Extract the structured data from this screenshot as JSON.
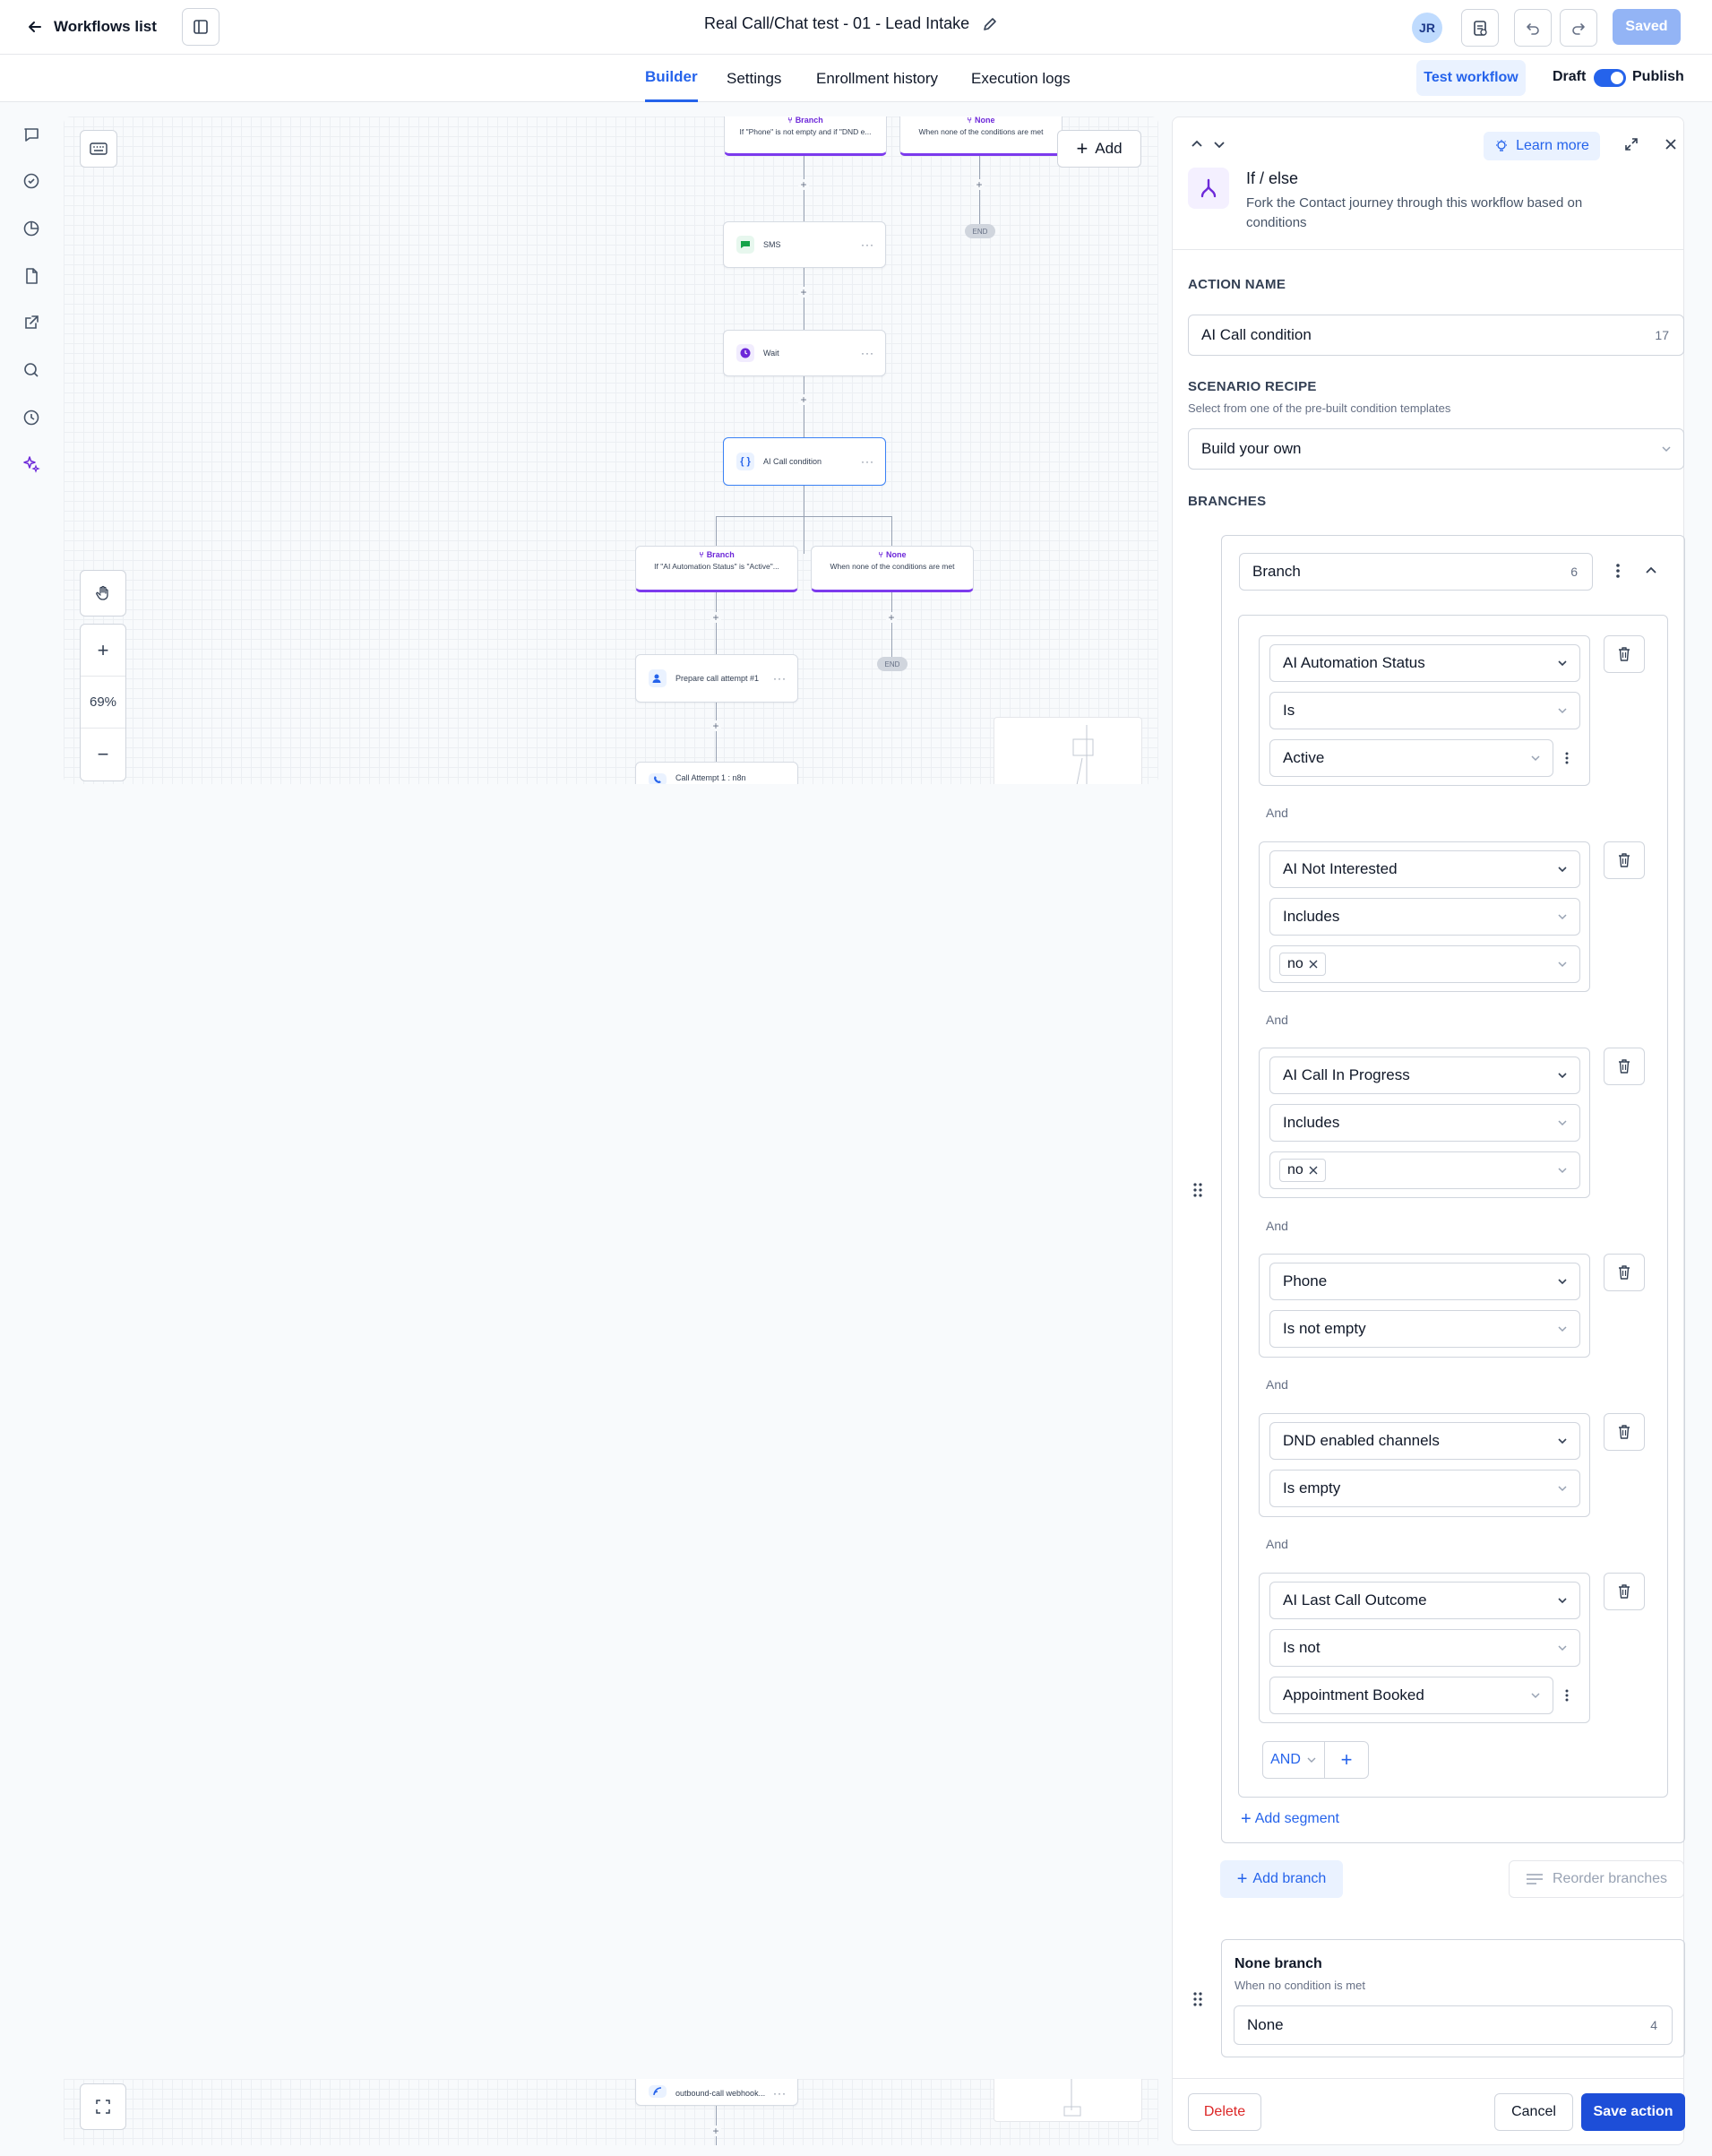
{
  "colors": {
    "accent": "#2563eb",
    "branch_purple": "#7c3aed",
    "danger": "#dc2626",
    "save": "#1d4ed8"
  },
  "topbar": {
    "back_label": "Workflows list",
    "title": "Real Call/Chat test - 01 - Lead Intake",
    "avatar_initials": "JR",
    "saved_label": "Saved"
  },
  "tabs": [
    {
      "label": "Builder",
      "active": true
    },
    {
      "label": "Settings"
    },
    {
      "label": "Enrollment history"
    },
    {
      "label": "Execution logs"
    }
  ],
  "header_actions": {
    "test_label": "Test workflow",
    "draft_label": "Draft",
    "publish_label": "Publish"
  },
  "rail_icons": [
    "chat-icon",
    "check-circle-icon",
    "pie-chart-icon",
    "document-icon",
    "external-link-icon",
    "search-icon",
    "history-icon",
    "sparkle-icon"
  ],
  "canvas": {
    "add_label": "Add",
    "zoom_level": "69%",
    "top_branch": {
      "title": "Branch",
      "desc": "If \"Phone\" is not empty and if \"DND e..."
    },
    "top_none": {
      "title": "None",
      "desc": "When none of the conditions are met"
    },
    "end_label": "END",
    "nodes": {
      "sms": "SMS",
      "wait": "Wait",
      "ai_call_condition": "AI Call condition",
      "prepare": "Prepare call attempt #1",
      "call_attempt": "Call Attempt 1 : n8n",
      "webhook": "outbound-call webhook..."
    },
    "mid_branch": {
      "title": "Branch",
      "desc": "If \"AI Automation Status\" is \"Active\"..."
    },
    "mid_none": {
      "title": "None",
      "desc": "When none of the conditions are met"
    }
  },
  "panel": {
    "learn_more": "Learn more",
    "title": "If / else",
    "description": "Fork the Contact journey through this workflow based on conditions",
    "action_name_label": "ACTION NAME",
    "action_name_value": "AI Call condition",
    "action_name_count": "17",
    "scenario_label": "SCENARIO RECIPE",
    "scenario_sub": "Select from one of the pre-built condition templates",
    "scenario_value": "Build your own",
    "branches_label": "BRANCHES",
    "branch_name": "Branch",
    "branch_count": "6",
    "and_label": "And",
    "conditions": [
      {
        "field": "AI Automation Status",
        "operator": "Is",
        "value": "Active"
      },
      {
        "field": "AI Not Interested",
        "operator": "Includes",
        "chip": "no"
      },
      {
        "field": "AI Call In Progress",
        "operator": "Includes",
        "chip": "no"
      },
      {
        "field": "Phone",
        "operator": "Is not empty"
      },
      {
        "field": "DND enabled channels",
        "operator": "Is empty"
      },
      {
        "field": "AI Last Call Outcome",
        "operator": "Is not",
        "value": "Appointment Booked"
      }
    ],
    "logic_op": "AND",
    "add_segment": "Add segment",
    "add_branch": "Add branch",
    "reorder_branches": "Reorder branches",
    "none_branch_title": "None branch",
    "none_branch_sub": "When no condition is met",
    "none_branch_value": "None",
    "none_branch_count": "4",
    "delete_label": "Delete",
    "cancel_label": "Cancel",
    "save_label": "Save action"
  }
}
